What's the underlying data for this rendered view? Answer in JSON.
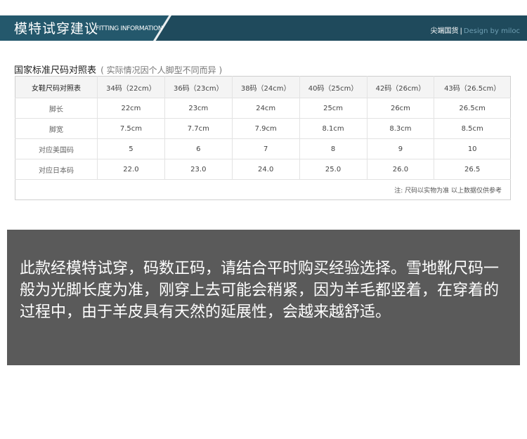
{
  "header": {
    "title": "模特试穿建议",
    "subtitle": "FITTING INFORMATION",
    "brand": "尖端国货",
    "separator": "|",
    "credit": "Design by miloc"
  },
  "size_chart": {
    "title": "国家标准尺码对照表",
    "note": "( 实际情况因个人脚型不同而异 )",
    "header_label": "女鞋尺码对照表",
    "columns": [
      "34码（22cm）",
      "36码（23cm）",
      "38码（24cm）",
      "40码（25cm）",
      "42码（26cm）",
      "43码（26.5cm）"
    ],
    "rows": [
      {
        "label": "脚长",
        "values": [
          "22cm",
          "23cm",
          "24cm",
          "25cm",
          "26cm",
          "26.5cm"
        ]
      },
      {
        "label": "脚宽",
        "values": [
          "7.5cm",
          "7.7cm",
          "7.9cm",
          "8.1cm",
          "8.3cm",
          "8.5cm"
        ]
      },
      {
        "label": "对应美国码",
        "values": [
          "5",
          "6",
          "7",
          "8",
          "9",
          "10"
        ]
      },
      {
        "label": "对应日本码",
        "values": [
          "22.0",
          "23.0",
          "24.0",
          "25.0",
          "26.0",
          "26.5"
        ]
      }
    ],
    "footnote": "注: 尺码以实物为准 以上数据仅供参考"
  },
  "notice": {
    "text": "此款经模特试穿，码数正码，请结合平时购买经验选择。雪地靴尺码一般为光脚长度为准，刚穿上去可能会稍紧，因为羊毛都竖着，在穿着的过程中，由于羊皮具有天然的延展性，会越来越舒适。"
  }
}
